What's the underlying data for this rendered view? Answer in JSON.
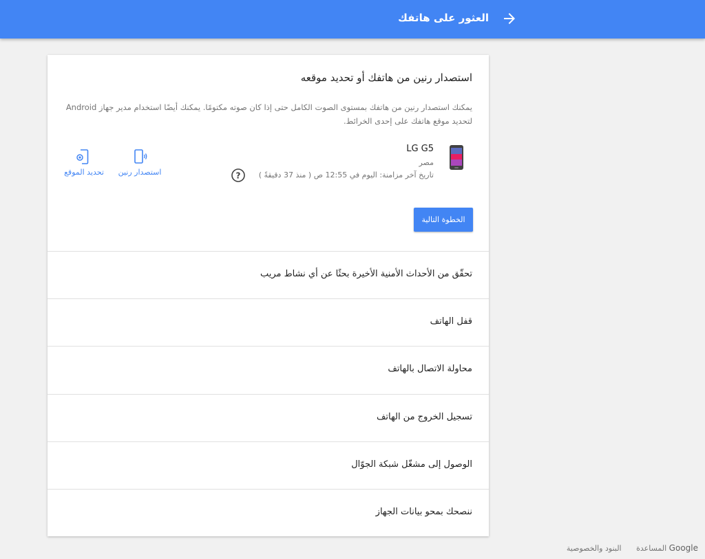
{
  "header": {
    "title": "العثور على هاتفك",
    "back_icon": "arrow-right-icon",
    "bg_color": "#4285f4"
  },
  "find_section": {
    "title": "استصدار رنين من هاتفك أو تحديد موقعه",
    "description": "يمكنك استصدار رنين من هاتفك بمستوى الصوت الكامل حتى إذا كان صوته مكتومًا. يمكنك أيضًا استخدام مدير جهاز Android لتحديد موقع هاتفك على إحدى الخرائط.",
    "device": {
      "name": "LG G5",
      "location": "مصر",
      "last_sync": "تاريخ آخر مزامنة: اليوم في 12:55 ص ( منذ 37 دقيقةً )"
    },
    "actions": {
      "ring_label": "استصدار رنين",
      "locate_label": "تحديد الموقع"
    },
    "next_button": "الخطوة التالية"
  },
  "rows": [
    "تحقّق من الأحداث الأمنية الأخيرة بحثًا عن أي نشاط مريب",
    "قفل الهاتف",
    "محاولة الاتصال بالهاتف",
    "تسجيل الخروج من الهاتف",
    "الوصول إلى مشغّل شبكة الجوّال",
    "ننصحك بمحو بيانات الجهاز"
  ],
  "footer": {
    "help": "المساعدة",
    "terms": "البنود والخصوصية",
    "brand": "Google"
  }
}
